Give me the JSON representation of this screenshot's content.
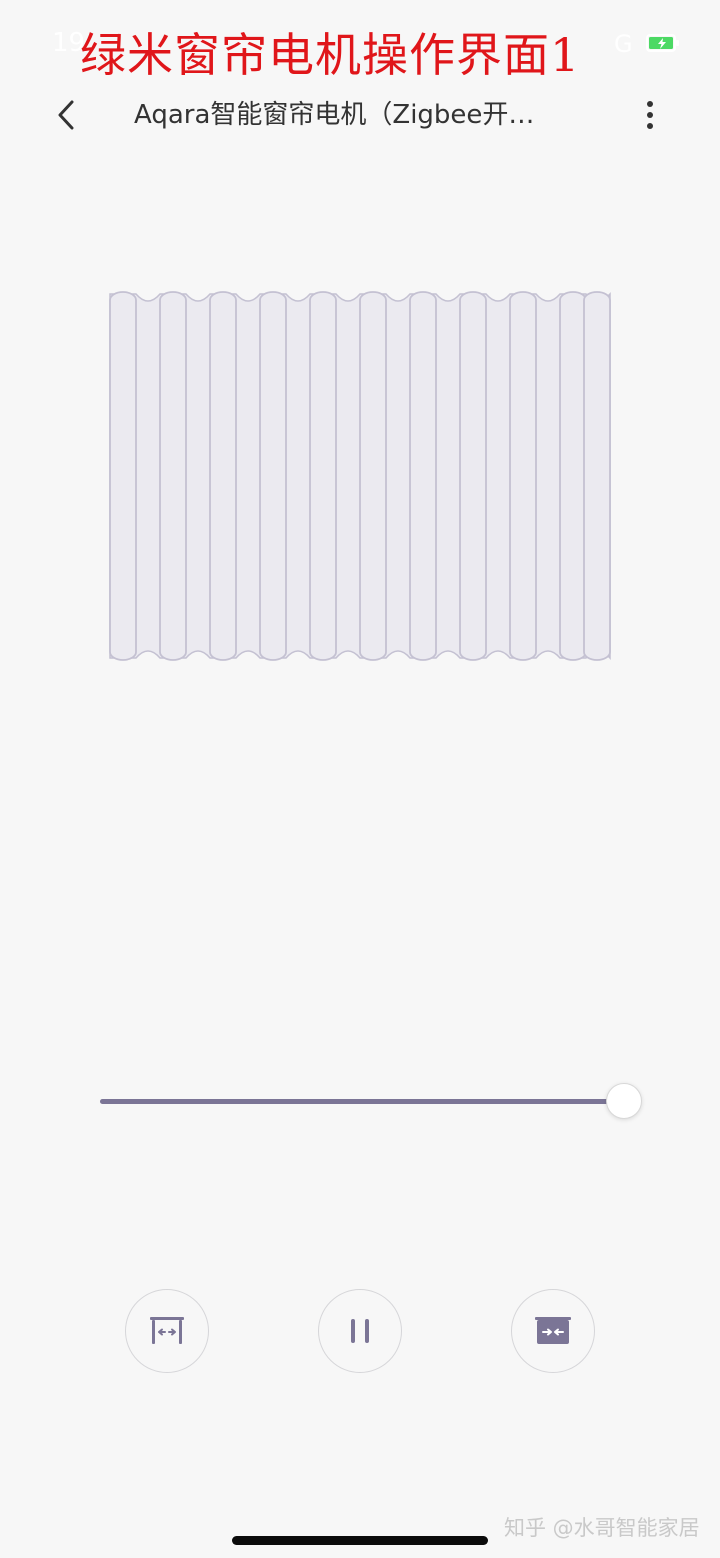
{
  "status_bar": {
    "time": "19",
    "network": "G",
    "battery_icon": "battery-charging-icon"
  },
  "overlay_title": "绿米窗帘电机操作界面1",
  "nav": {
    "back_icon": "chevron-left-icon",
    "title": "Aqara智能窗帘电机（Zigbee开…",
    "more_icon": "more-vertical-icon"
  },
  "curtain": {
    "icon": "curtain-icon",
    "fold_count": 10
  },
  "slider": {
    "value_percent": 100
  },
  "controls": [
    {
      "name": "open-button",
      "icon": "curtain-open-icon"
    },
    {
      "name": "pause-button",
      "icon": "pause-icon"
    },
    {
      "name": "close-button",
      "icon": "curtain-close-icon"
    }
  ],
  "watermark": "知乎 @水哥智能家居",
  "colors": {
    "accent": "#7b7596",
    "curtain_fill": "#ebeaf0",
    "curtain_stroke": "#c4c1d2",
    "overlay_text": "#e0161a",
    "background": "#f7f7f7"
  }
}
